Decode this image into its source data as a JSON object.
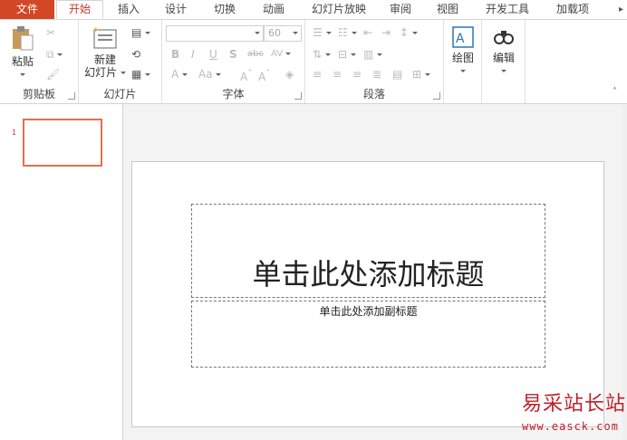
{
  "tabs": {
    "file": "文件",
    "items": [
      "开始",
      "插入",
      "设计",
      "切换",
      "动画",
      "幻灯片放映",
      "审阅",
      "视图",
      "开发工具",
      "加载项"
    ],
    "active": "开始"
  },
  "ribbon": {
    "clipboard": {
      "paste_label": "粘贴",
      "group_label": "剪贴板"
    },
    "slides": {
      "new_slide_line1": "新建",
      "new_slide_line2": "幻灯片",
      "group_label": "幻灯片"
    },
    "font": {
      "font_name": "",
      "font_size": "60",
      "group_label": "字体"
    },
    "paragraph": {
      "group_label": "段落"
    },
    "drawing": {
      "label": "绘图"
    },
    "editing": {
      "label": "编辑"
    }
  },
  "thumbnails": {
    "slide_number": "1"
  },
  "slide": {
    "title_placeholder": "单击此处添加标题",
    "subtitle_placeholder": "单击此处添加副标题"
  },
  "watermark": {
    "text": "易采站长站",
    "url": "www.easck.com"
  },
  "colors": {
    "accent": "#d24726",
    "thumb_border": "#e07050"
  },
  "icons": [
    "paste-icon",
    "cut-icon",
    "copy-icon",
    "format-painter-icon",
    "new-slide-icon",
    "layout-icon",
    "reset-icon",
    "section-icon",
    "bold-icon",
    "italic-icon",
    "underline-icon",
    "shadow-icon",
    "strikethrough-icon",
    "char-spacing-icon",
    "bullets-icon",
    "numbering-icon",
    "align-left-icon",
    "align-center-icon",
    "align-right-icon",
    "justify-icon",
    "drawing-icon",
    "find-icon"
  ]
}
